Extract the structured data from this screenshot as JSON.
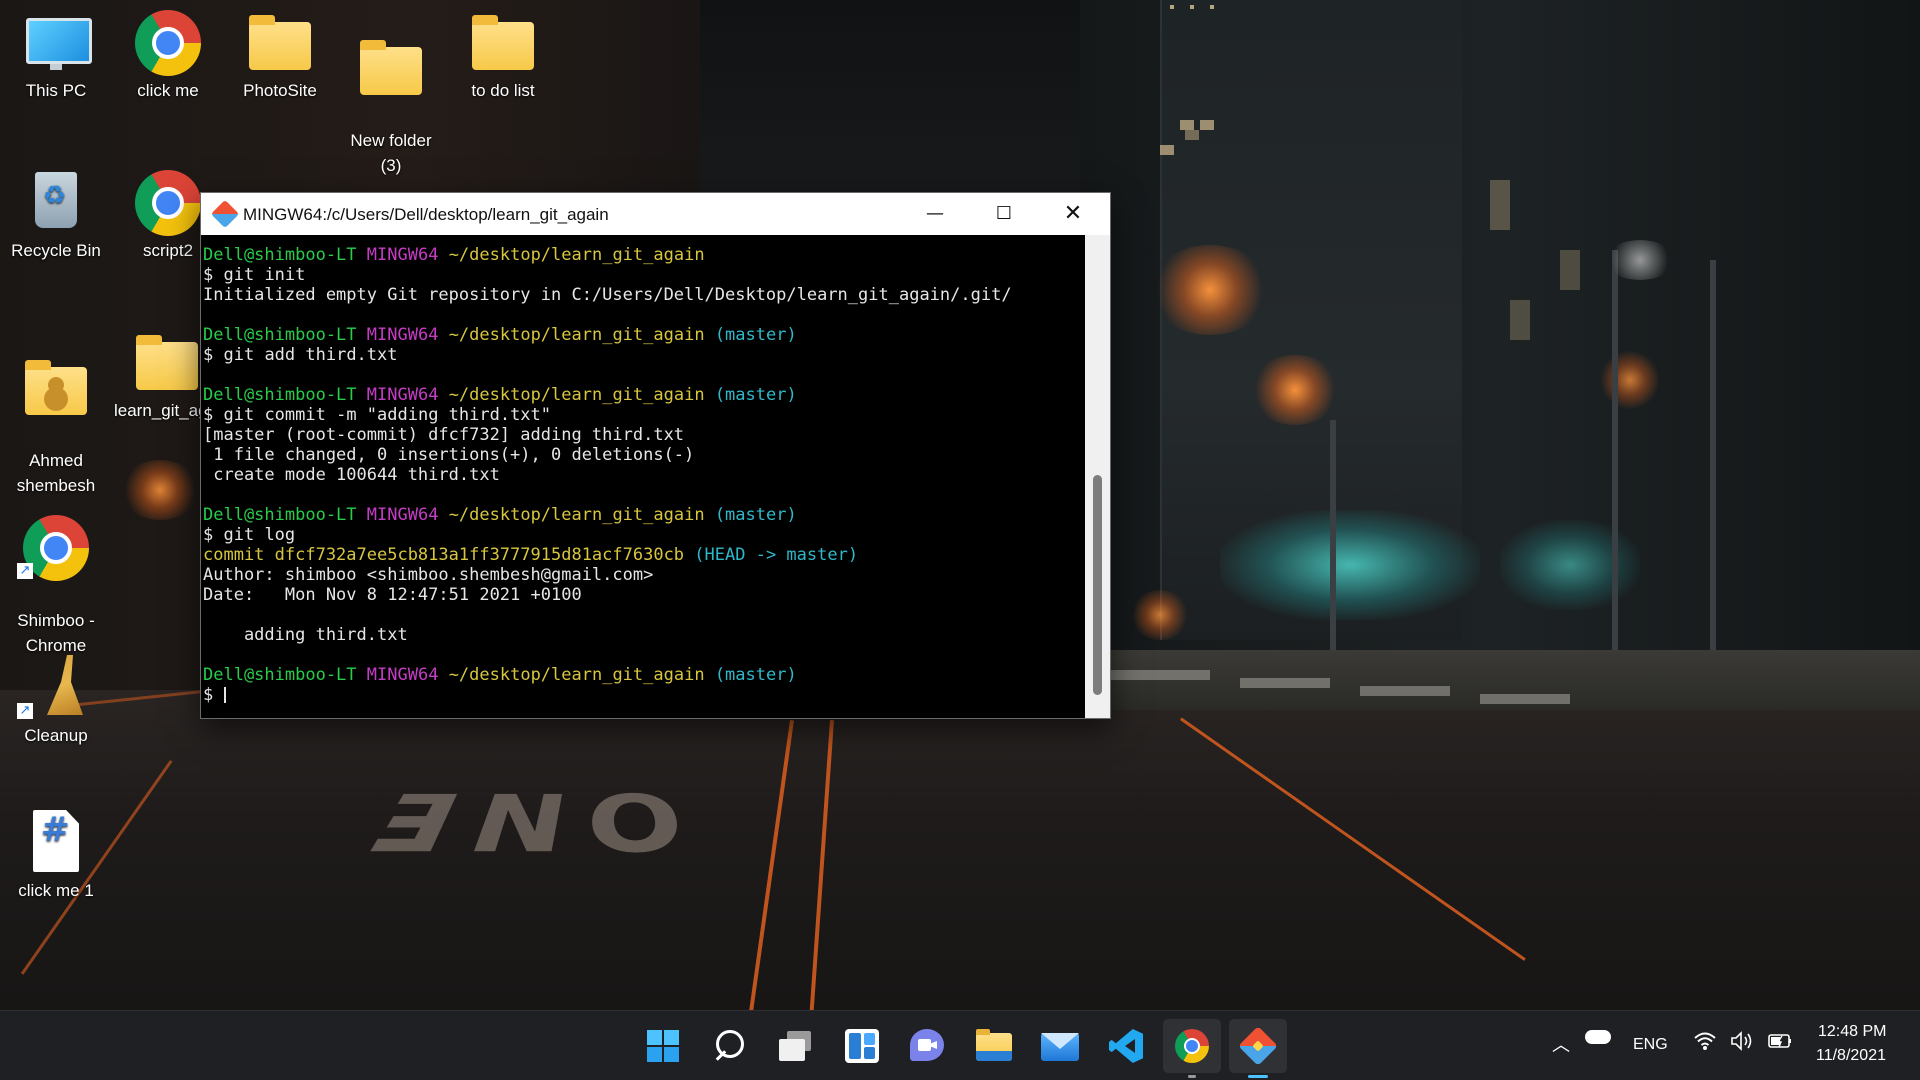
{
  "desktop": {
    "icons": [
      {
        "label": "This PC"
      },
      {
        "label": "click me"
      },
      {
        "label": "PhotoSite"
      },
      {
        "label": "New folder\n(3)"
      },
      {
        "label": "to do list"
      },
      {
        "label": "Recycle Bin"
      },
      {
        "label": "script2"
      },
      {
        "label": "Ahmed\nshembesh"
      },
      {
        "label": "learn_git_ag"
      },
      {
        "label": "Shimboo -\nChrome"
      },
      {
        "label": "Cleanup"
      },
      {
        "label": "click me 1"
      }
    ]
  },
  "terminal": {
    "title": "MINGW64:/c/Users/Dell/desktop/learn_git_again",
    "controls": {
      "minimize": "—",
      "maximize": "☐",
      "close": "✕"
    },
    "prompt": {
      "user": "Dell@shimboo-LT",
      "env": "MINGW64",
      "path": "~/desktop/learn_git_again",
      "branch": "(master)",
      "symbol": "$"
    },
    "lines": [
      {
        "type": "prompt",
        "branch": false
      },
      {
        "type": "cmd",
        "text": "git init"
      },
      {
        "type": "out",
        "text": "Initialized empty Git repository in C:/Users/Dell/Desktop/learn_git_again/.git/"
      },
      {
        "type": "blank"
      },
      {
        "type": "prompt",
        "branch": true
      },
      {
        "type": "cmd",
        "text": "git add third.txt"
      },
      {
        "type": "blank"
      },
      {
        "type": "prompt",
        "branch": true
      },
      {
        "type": "cmd",
        "text": "git commit -m \"adding third.txt\""
      },
      {
        "type": "out",
        "text": "[master (root-commit) dfcf732] adding third.txt"
      },
      {
        "type": "out",
        "text": " 1 file changed, 0 insertions(+), 0 deletions(-)"
      },
      {
        "type": "out",
        "text": " create mode 100644 third.txt"
      },
      {
        "type": "blank"
      },
      {
        "type": "prompt",
        "branch": true
      },
      {
        "type": "cmd",
        "text": "git log"
      },
      {
        "type": "commit",
        "hash": "commit dfcf732a7ee5cb813a1ff3777915d81acf7630cb",
        "head": "(HEAD -> master)"
      },
      {
        "type": "out",
        "text": "Author: shimboo <shimboo.shembesh@gmail.com>"
      },
      {
        "type": "out",
        "text": "Date:   Mon Nov 8 12:47:51 2021 +0100"
      },
      {
        "type": "blank"
      },
      {
        "type": "out",
        "text": "    adding third.txt"
      },
      {
        "type": "blank"
      },
      {
        "type": "prompt",
        "branch": true
      },
      {
        "type": "input",
        "text": ""
      }
    ]
  },
  "taskbar": {
    "apps": [
      {
        "name": "start-button",
        "color": "#4cc2ff"
      },
      {
        "name": "search-button",
        "color": "#ffffff"
      },
      {
        "name": "task-view-button",
        "color": "#ffffff"
      },
      {
        "name": "widgets-button",
        "color": "#4aa8ff"
      },
      {
        "name": "chat-button",
        "color": "#7b83eb"
      },
      {
        "name": "file-explorer-button",
        "color": "#f7c948"
      },
      {
        "name": "mail-button",
        "color": "#1e90ff"
      },
      {
        "name": "vscode-button",
        "color": "#22a8f1"
      },
      {
        "name": "chrome-button",
        "color": "#db4437"
      },
      {
        "name": "git-bash-button",
        "color": "#f05133"
      }
    ],
    "tray": {
      "language": "ENG",
      "time": "12:48 PM",
      "date": "11/8/2021"
    }
  }
}
